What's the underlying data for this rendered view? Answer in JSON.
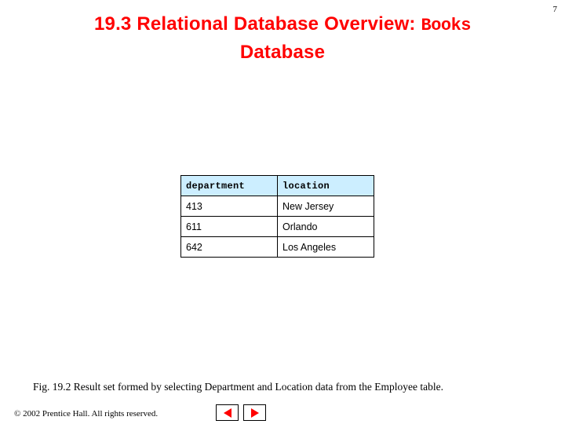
{
  "slide": {
    "number": "7",
    "title_part1": "19.3  Relational Database Overview: ",
    "title_mono": "Books",
    "title_part2": "Database"
  },
  "table": {
    "headers": [
      "department",
      "location"
    ],
    "rows": [
      [
        "413",
        "New Jersey"
      ],
      [
        "611",
        "Orlando"
      ],
      [
        "642",
        "Los Angeles"
      ]
    ]
  },
  "caption": "Fig. 19.2   Result set formed by selecting Department and Location data from the Employee table.",
  "footer": "© 2002 Prentice Hall. All rights reserved.",
  "nav": {
    "prev": "previous-slide",
    "next": "next-slide"
  },
  "colors": {
    "title": "#ff0000",
    "header_bg": "#cceeff",
    "arrow": "#ff0000"
  }
}
